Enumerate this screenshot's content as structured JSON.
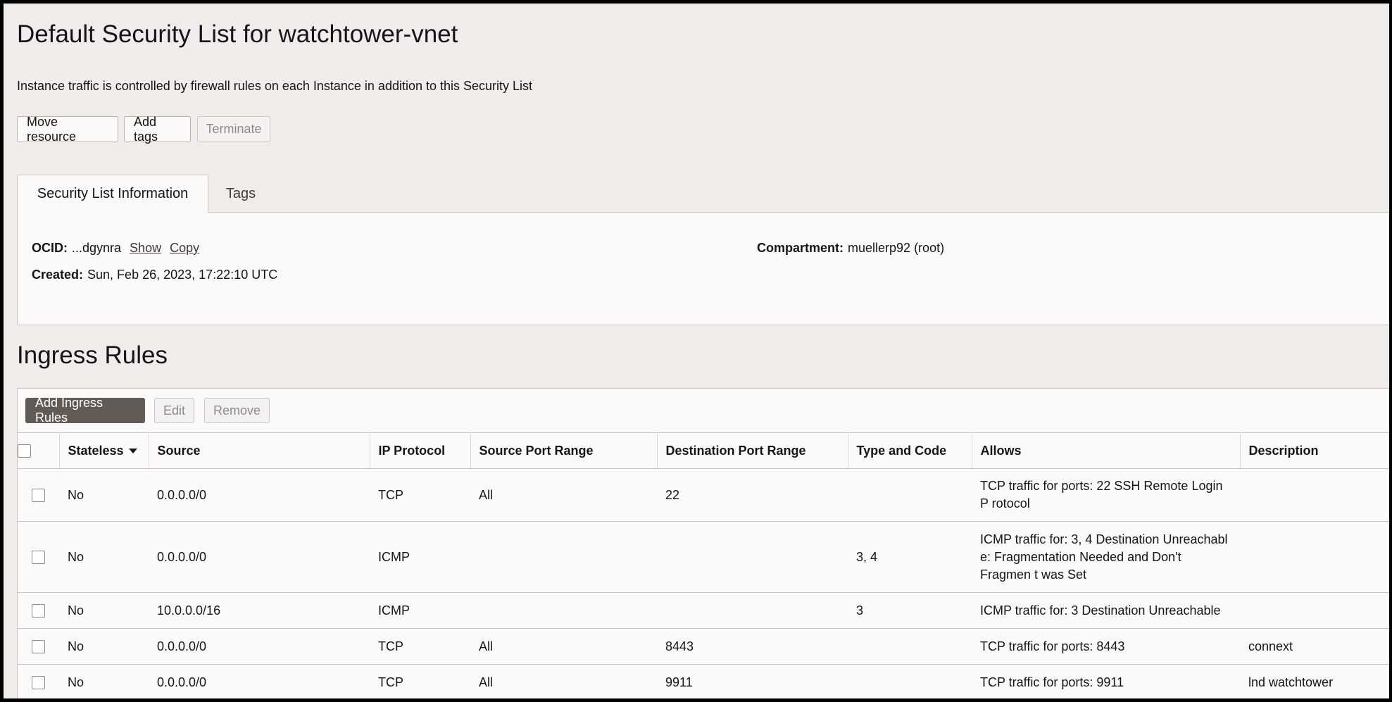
{
  "header": {
    "title": "Default Security List for watchtower-vnet",
    "subtitle": "Instance traffic is controlled by firewall rules on each Instance in addition to this Security List"
  },
  "actions": {
    "move_resource": "Move resource",
    "add_tags": "Add tags",
    "terminate": "Terminate"
  },
  "tabs": [
    {
      "label": "Security List Information",
      "active": true
    },
    {
      "label": "Tags",
      "active": false
    }
  ],
  "info": {
    "ocid_label": "OCID:",
    "ocid_value": "...dgynra",
    "show_link": "Show",
    "copy_link": "Copy",
    "created_label": "Created:",
    "created_value": "Sun, Feb 26, 2023, 17:22:10 UTC",
    "compartment_label": "Compartment:",
    "compartment_value": "muellerp92 (root)"
  },
  "ingress": {
    "title": "Ingress Rules",
    "add_button": "Add Ingress Rules",
    "edit_button": "Edit",
    "remove_button": "Remove",
    "columns": [
      "Stateless",
      "Source",
      "IP Protocol",
      "Source Port Range",
      "Destination Port Range",
      "Type and Code",
      "Allows",
      "Description"
    ],
    "rows": [
      {
        "stateless": "No",
        "source": "0.0.0.0/0",
        "protocol": "TCP",
        "src_port": "All",
        "dst_port": "22",
        "type_code": "",
        "allows": "TCP traffic for ports: 22 SSH Remote Login P rotocol",
        "description": ""
      },
      {
        "stateless": "No",
        "source": "0.0.0.0/0",
        "protocol": "ICMP",
        "src_port": "",
        "dst_port": "",
        "type_code": "3, 4",
        "allows": "ICMP traffic for: 3, 4 Destination Unreachabl e: Fragmentation Needed and Don't Fragmen t was Set",
        "description": ""
      },
      {
        "stateless": "No",
        "source": "10.0.0.0/16",
        "protocol": "ICMP",
        "src_port": "",
        "dst_port": "",
        "type_code": "3",
        "allows": "ICMP traffic for: 3 Destination Unreachable",
        "description": ""
      },
      {
        "stateless": "No",
        "source": "0.0.0.0/0",
        "protocol": "TCP",
        "src_port": "All",
        "dst_port": "8443",
        "type_code": "",
        "allows": "TCP traffic for ports: 8443",
        "description": "connext"
      },
      {
        "stateless": "No",
        "source": "0.0.0.0/0",
        "protocol": "TCP",
        "src_port": "All",
        "dst_port": "9911",
        "type_code": "",
        "allows": "TCP traffic for ports: 9911",
        "description": "lnd watchtower"
      }
    ]
  }
}
